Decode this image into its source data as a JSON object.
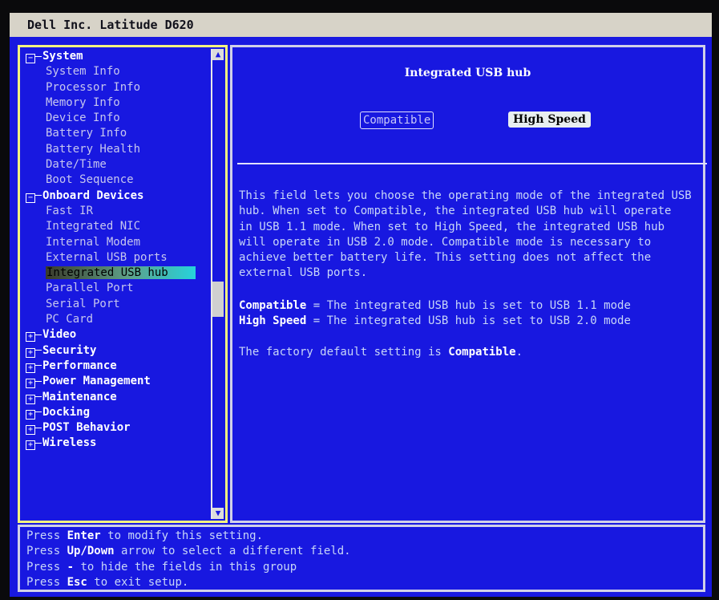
{
  "window": {
    "title": "Dell Inc. Latitude D620"
  },
  "tree": [
    {
      "label": "System",
      "type": "group",
      "expanded": true
    },
    {
      "label": "System Info",
      "type": "child"
    },
    {
      "label": "Processor Info",
      "type": "child"
    },
    {
      "label": "Memory Info",
      "type": "child"
    },
    {
      "label": "Device Info",
      "type": "child"
    },
    {
      "label": "Battery Info",
      "type": "child"
    },
    {
      "label": "Battery Health",
      "type": "child"
    },
    {
      "label": "Date/Time",
      "type": "child"
    },
    {
      "label": "Boot Sequence",
      "type": "child"
    },
    {
      "label": "Onboard Devices",
      "type": "group",
      "expanded": true
    },
    {
      "label": "Fast IR",
      "type": "child"
    },
    {
      "label": "Integrated NIC",
      "type": "child"
    },
    {
      "label": "Internal Modem",
      "type": "child"
    },
    {
      "label": "External USB ports",
      "type": "child"
    },
    {
      "label": "Integrated USB hub",
      "type": "child",
      "selected": true
    },
    {
      "label": "Parallel Port",
      "type": "child"
    },
    {
      "label": "Serial Port",
      "type": "child"
    },
    {
      "label": "PC Card",
      "type": "child"
    },
    {
      "label": "Video",
      "type": "group",
      "expanded": false
    },
    {
      "label": "Security",
      "type": "group",
      "expanded": false
    },
    {
      "label": "Performance",
      "type": "group",
      "expanded": false
    },
    {
      "label": "Power Management",
      "type": "group",
      "expanded": false
    },
    {
      "label": "Maintenance",
      "type": "group",
      "expanded": false
    },
    {
      "label": "Docking",
      "type": "group",
      "expanded": false
    },
    {
      "label": "POST Behavior",
      "type": "group",
      "expanded": false
    },
    {
      "label": "Wireless",
      "type": "group",
      "expanded": false
    }
  ],
  "detail": {
    "title": "Integrated USB hub",
    "options": {
      "compatible": "Compatible",
      "high_speed": "High Speed",
      "selected": "High Speed"
    },
    "description": [
      "This field lets you choose the operating mode of the integrated USB",
      "hub.  When set to Compatible, the integrated USB hub will operate",
      "in USB 1.1 mode.  When set to High Speed, the integrated USB hub",
      "will operate in USB 2.0 mode.  Compatible mode is necessary to",
      "achieve better battery life.  This setting does not affect the",
      "external USB ports."
    ],
    "definitions": [
      {
        "term": "Compatible",
        "text": " = The integrated USB hub is set to USB 1.1 mode"
      },
      {
        "term": "High Speed",
        "text": " = The integrated USB hub is set to USB 2.0 mode"
      }
    ],
    "default_prefix": "The factory default setting is ",
    "default_value": "Compatible",
    "default_suffix": "."
  },
  "help": [
    {
      "pre": "Press ",
      "key": "Enter",
      "post": " to modify this setting."
    },
    {
      "pre": "Press ",
      "key": "Up/Down",
      "post": " arrow to select a different field."
    },
    {
      "pre": "Press ",
      "key": "-",
      "post": " to hide the fields in this group"
    },
    {
      "pre": "Press ",
      "key": "Esc",
      "post": " to exit setup."
    }
  ],
  "icons": {
    "scroll_up": "arrow-up-icon",
    "scroll_down": "arrow-down-icon",
    "expand": "plus-box-icon",
    "collapse": "minus-box-icon"
  },
  "colors": {
    "screen_bg": "#1818e0",
    "title_bar": "#d7d3c8",
    "tree_border": "#f4f480"
  }
}
